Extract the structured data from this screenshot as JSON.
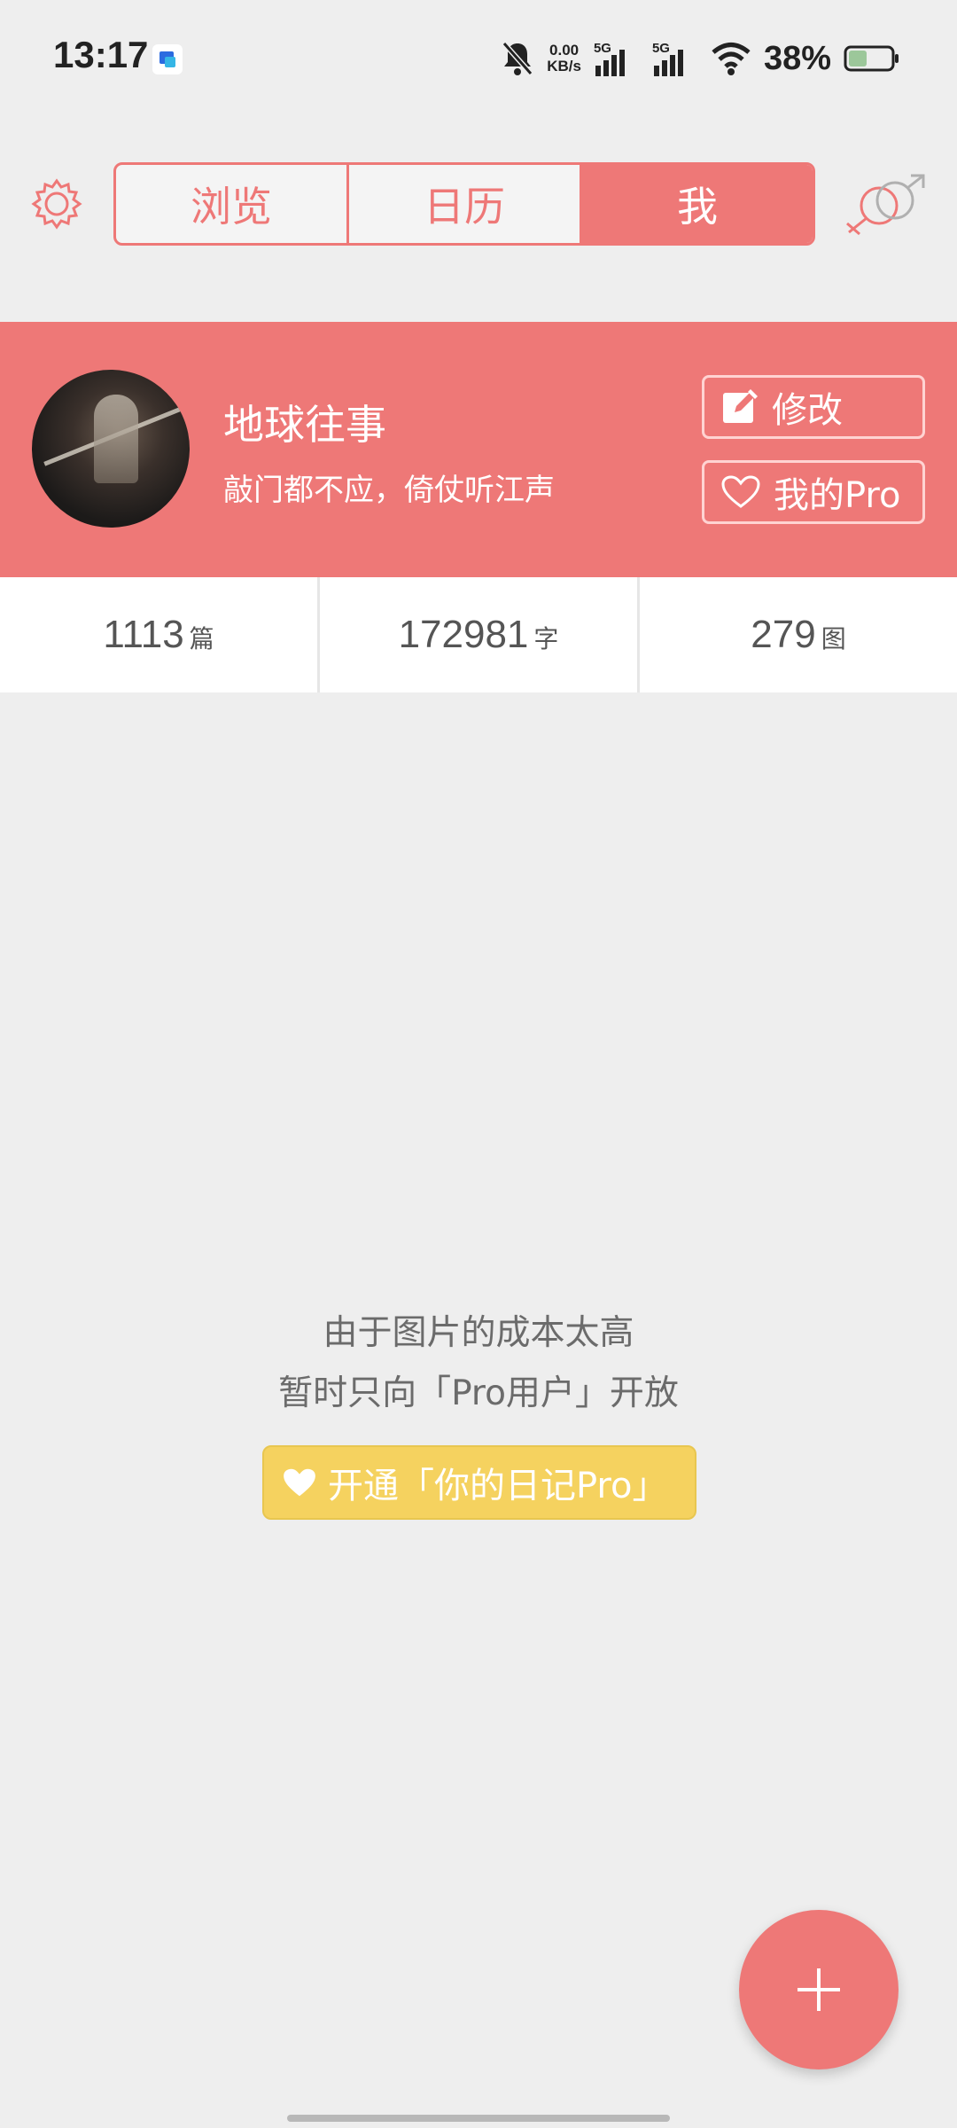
{
  "status_bar": {
    "time": "13:17",
    "net_speed_value": "0.00",
    "net_speed_unit": "KB/s",
    "sim1": "5G",
    "sim2": "5G",
    "battery_percent": "38%",
    "icons": [
      "app-notification-icon",
      "mute-bell-icon",
      "signal-icon",
      "wifi-icon",
      "battery-icon"
    ]
  },
  "nav": {
    "tabs": [
      {
        "label": "浏览",
        "active": false
      },
      {
        "label": "日历",
        "active": false
      },
      {
        "label": "我",
        "active": true
      }
    ],
    "left_icon": "gear-icon",
    "right_icon": "gender-symbol-icon"
  },
  "profile": {
    "name": "地球往事",
    "motto": "敲门都不应，倚仗听江声",
    "edit_label": "修改",
    "pro_label": "我的Pro"
  },
  "stats": [
    {
      "value": "1113",
      "unit": "篇"
    },
    {
      "value": "172981",
      "unit": "字"
    },
    {
      "value": "279",
      "unit": "图"
    }
  ],
  "empty_state": {
    "line1": "由于图片的成本太高",
    "line2": "暂时只向「Pro用户」开放",
    "cta_label": "开通「你的日记Pro」"
  },
  "colors": {
    "accent": "#ee7877",
    "pro_yellow": "#f5d25f",
    "background": "#eeeeee"
  }
}
